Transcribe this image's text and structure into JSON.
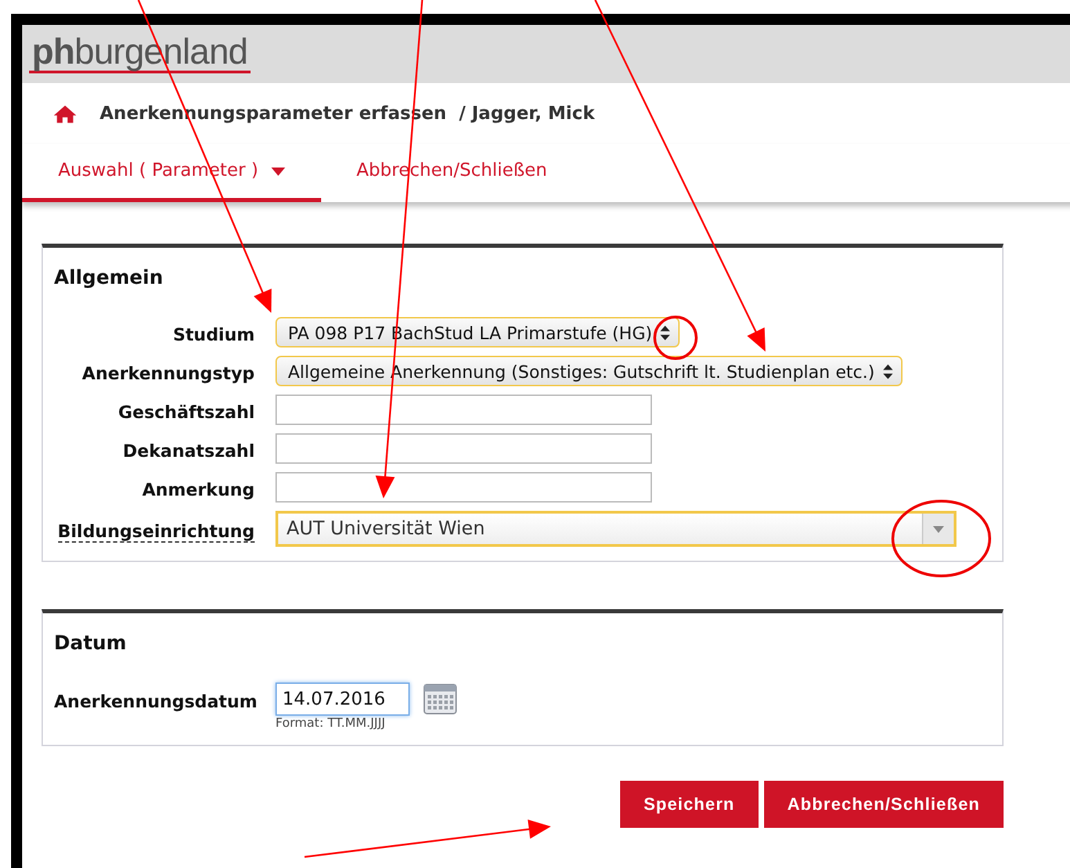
{
  "logo": {
    "bold": "ph",
    "rest": "burgenland"
  },
  "breadcrumb": {
    "title": "Anerkennungsparameter erfassen  / Jagger, Mick"
  },
  "tabs": [
    {
      "label": "Auswahl ( Parameter )",
      "selected": true,
      "dropdown": true
    },
    {
      "label": "Abbrechen/Schließen",
      "selected": false,
      "dropdown": false
    }
  ],
  "sections": [
    {
      "title": "Allgemein",
      "fields": [
        {
          "label": "Studium",
          "kind": "select",
          "value": "PA 098 P17 BachStud LA Primarstufe (HG)",
          "help": false
        },
        {
          "label": "Anerkennungstyp",
          "kind": "select",
          "value": "Allgemeine Anerkennung (Sonstiges: Gutschrift lt. Studienplan etc.)",
          "help": false
        },
        {
          "label": "Geschäftszahl",
          "kind": "text",
          "help": false
        },
        {
          "label": "Dekanatszahl",
          "kind": "text",
          "help": false
        },
        {
          "label": "Anmerkung",
          "kind": "text",
          "help": false
        },
        {
          "label": "Bildungseinrichtung",
          "kind": "combobox",
          "value": "AUT Universität Wien",
          "help": true
        }
      ]
    },
    {
      "title": "Datum",
      "fields": [
        {
          "label": "Anerkennungsdatum",
          "kind": "date",
          "value": "14.07.2016",
          "hint": "Format: TT.MM.JJJJ",
          "help": false
        }
      ]
    }
  ],
  "buttons": [
    "Speichern",
    "Abbrechen/Schließen"
  ]
}
